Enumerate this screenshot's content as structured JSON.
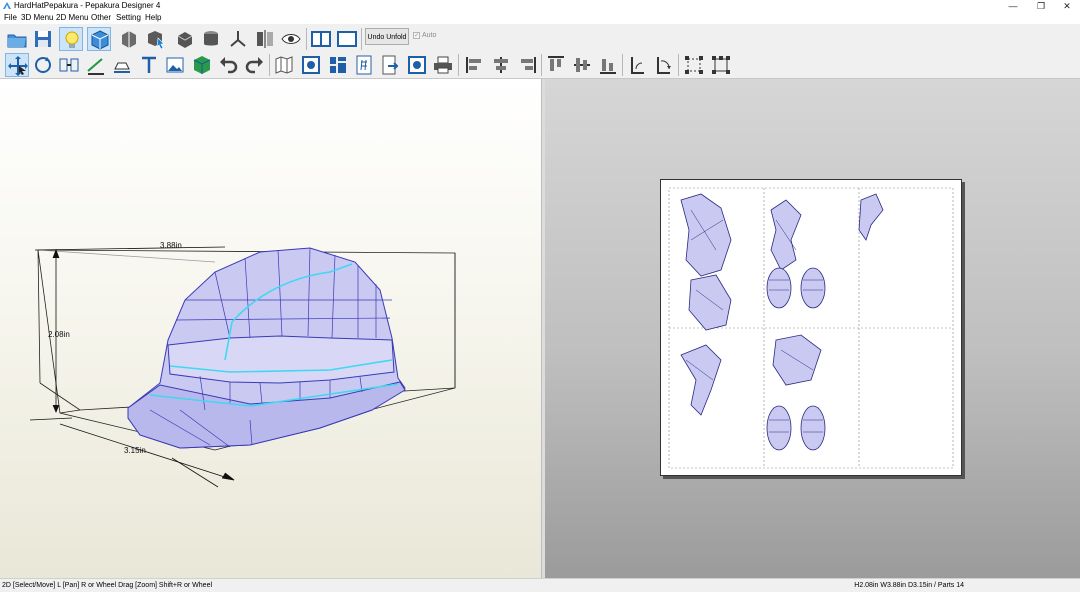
{
  "window": {
    "title": "HardHatPepakura - Pepakura Designer 4",
    "minimize_glyph": "—",
    "restore_glyph": "❐",
    "close_glyph": "✕"
  },
  "menu": {
    "items": [
      "File",
      "3D Menu",
      "2D Menu",
      "Other",
      "Setting",
      "Help"
    ]
  },
  "toolbar": {
    "undo_unfold_label": "Undo Unfold",
    "auto_label": "Auto",
    "auto_checked": true,
    "auto_enabled": false,
    "row1_icons": [
      "open-folder-icon",
      "save-icon",
      "light-bulb-icon",
      "texture-cube-icon",
      "flip-faces-icon",
      "select-cube-icon",
      "cube-edit-icon",
      "cylinder-icon",
      "edge-join-icon",
      "mirror-icon",
      "eye-view-icon",
      "two-pane-view-icon",
      "single-pane-view-icon"
    ],
    "row2_icons": [
      "select-move-icon",
      "rotate-icon",
      "join-parts-icon",
      "fold-line-icon",
      "glue-flap-icon",
      "text-icon",
      "image-icon",
      "color-cube-icon",
      "undo-icon",
      "redo-icon",
      "unfold-map-icon",
      "face-select-icon",
      "parts-arrange-icon",
      "page-number-icon",
      "export-icon",
      "print-preview-icon",
      "print-icon",
      "align-left-icon",
      "align-center-icon",
      "align-right-icon",
      "align-top-icon",
      "align-middle-icon",
      "align-bottom-icon",
      "rotate-part-icon",
      "rotate-part-ccw-icon",
      "snap-grid-icon",
      "snap-parts-icon"
    ]
  },
  "view3d": {
    "width_label": "3.88in",
    "height_label": "2.08in",
    "depth_label": "3.15in"
  },
  "statusbar": {
    "left_text": "2D [Select/Move] L [Pan] R or Wheel Drag [Zoom] Shift+R or Wheel",
    "right_text": "H2.08in W3.88in D3.15in / Parts 14"
  },
  "colors": {
    "mesh_fill": "#c9c9f2",
    "mesh_edge": "#3a3ab8",
    "seam_edge": "#40d8f0",
    "accent": "#2e7bd6"
  }
}
